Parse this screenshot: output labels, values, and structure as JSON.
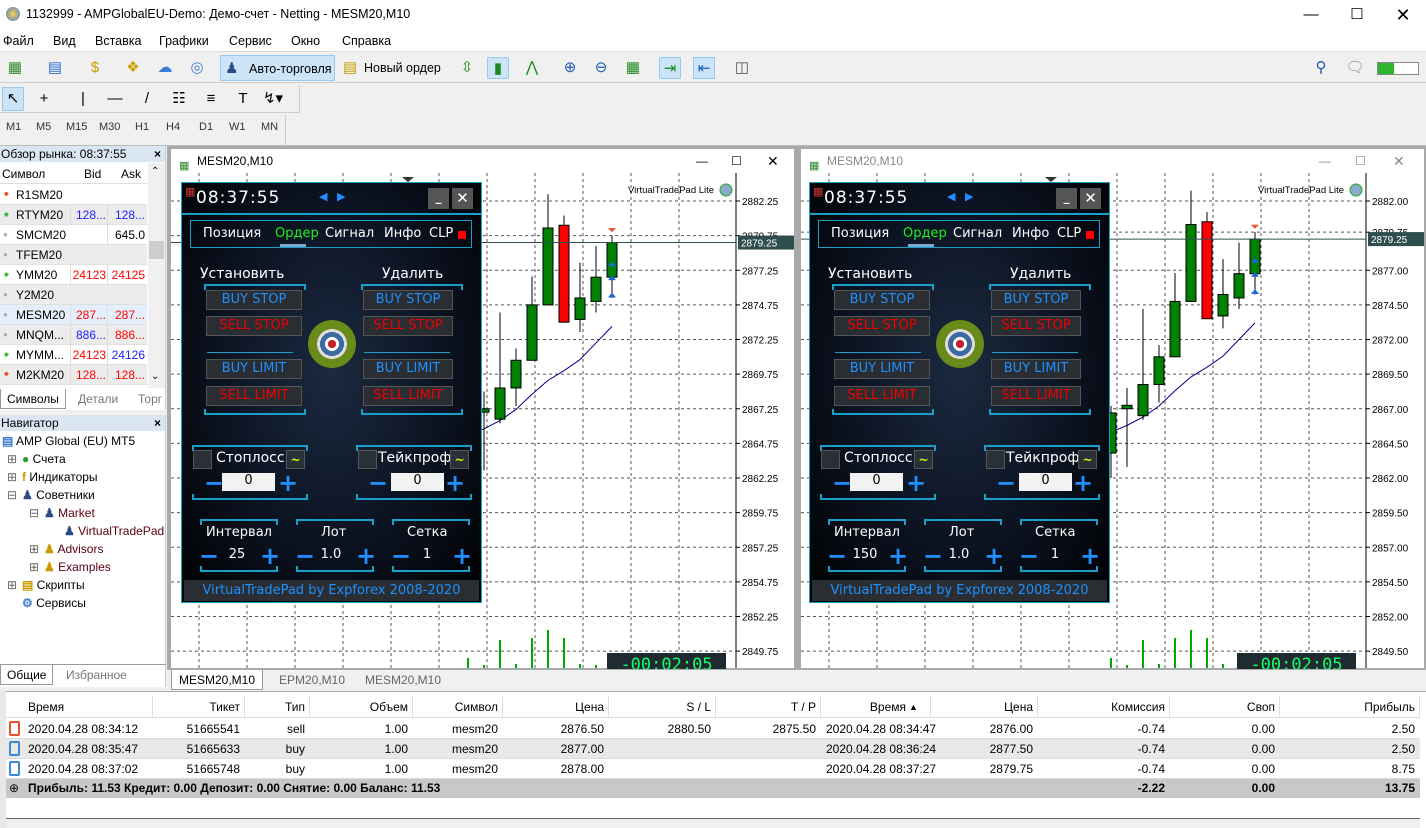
{
  "window": {
    "title": "1132999 - AMPGlobalEU-Demo: Демо-счет - Netting - MESM20,M10"
  },
  "menu": [
    "Файл",
    "Вид",
    "Вставка",
    "Графики",
    "Сервис",
    "Окно",
    "Справка"
  ],
  "toolbar": {
    "autotrading": "Авто-торговля",
    "new_order": "Новый ордер"
  },
  "timeframes": [
    "M1",
    "M5",
    "M15",
    "M30",
    "H1",
    "H4",
    "D1",
    "W1",
    "MN"
  ],
  "market_watch": {
    "title": "Обзор рынка: 08:37:55",
    "columns": [
      "Символ",
      "Bid",
      "Ask"
    ],
    "rows": [
      {
        "symbol": "R1SM20",
        "bid": "",
        "ask": "",
        "trend": "down",
        "bid_color": "#000",
        "ask_color": "#000"
      },
      {
        "symbol": "RTYM20",
        "bid": "128...",
        "ask": "128...",
        "trend": "up",
        "bid_color": "#2020ff",
        "ask_color": "#2020ff"
      },
      {
        "symbol": "SMCM20",
        "bid": "",
        "ask": "645.0",
        "trend": "none",
        "bid_color": "#000",
        "ask_color": "#000"
      },
      {
        "symbol": "TFEM20",
        "bid": "",
        "ask": "",
        "trend": "none",
        "bid_color": "#000",
        "ask_color": "#000"
      },
      {
        "symbol": "YMM20",
        "bid": "24123",
        "ask": "24125",
        "trend": "up",
        "bid_color": "#ff0000",
        "ask_color": "#ff0000"
      },
      {
        "symbol": "Y2M20",
        "bid": "",
        "ask": "",
        "trend": "none",
        "bid_color": "#000",
        "ask_color": "#000"
      },
      {
        "symbol": "MESM20",
        "bid": "287...",
        "ask": "287...",
        "trend": "none",
        "bid_color": "#ff0000",
        "ask_color": "#ff0000"
      },
      {
        "symbol": "MNQM...",
        "bid": "886...",
        "ask": "886...",
        "trend": "none",
        "bid_color": "#2020ff",
        "ask_color": "#ff0000"
      },
      {
        "symbol": "MYMM...",
        "bid": "24123",
        "ask": "24126",
        "trend": "up",
        "bid_color": "#ff0000",
        "ask_color": "#2020ff"
      },
      {
        "symbol": "M2KM20",
        "bid": "128...",
        "ask": "128...",
        "trend": "down",
        "bid_color": "#ff0000",
        "ask_color": "#ff0000"
      }
    ],
    "tabs": [
      "Символы",
      "Детали",
      "Торг"
    ]
  },
  "navigator": {
    "title": "Навигатор",
    "items": [
      "AMP Global (EU) MT5",
      "Счета",
      "Индикаторы",
      "Советники",
      "Market",
      "VirtualTradePad",
      "Advisors",
      "Examples",
      "Скрипты",
      "Сервисы"
    ],
    "tabs": [
      "Общие",
      "Избранное"
    ]
  },
  "charts": [
    {
      "title": "MESM20,M10",
      "ticks": [
        "2882.25",
        "2879.75",
        "2877.25",
        "2874.75",
        "2872.25",
        "2869.75",
        "2867.25",
        "2864.75",
        "2862.25",
        "2859.75",
        "2857.25",
        "2854.75",
        "2852.25",
        "2849.75"
      ],
      "current_price": "2879.25",
      "indicator_label": "VirtualTradePad  Lite",
      "countdown": "-00:02:05"
    },
    {
      "title": "MESM20,M10",
      "ticks": [
        "2882.00",
        "2879.75",
        "2877.00",
        "2874.50",
        "2872.00",
        "2869.50",
        "2867.00",
        "2864.50",
        "2862.00",
        "2859.50",
        "2857.00",
        "2854.50",
        "2852.00",
        "2849.50"
      ],
      "current_price": "2879.25",
      "indicator_label": "VirtualTradePad  Lite",
      "countdown": "-00:02:05"
    }
  ],
  "candles": [
    {
      "o": 2863.8,
      "h": 2867.2,
      "l": 2862.0,
      "c": 2866.7,
      "ma": 2865.3,
      "v": 10
    },
    {
      "o": 2867.0,
      "h": 2868.5,
      "l": 2862.8,
      "c": 2867.25,
      "ma": 2865.8,
      "v": 3
    },
    {
      "o": 2866.5,
      "h": 2874.2,
      "l": 2866.2,
      "c": 2868.75,
      "ma": 2866.4,
      "v": 28
    },
    {
      "o": 2868.75,
      "h": 2871.6,
      "l": 2867.45,
      "c": 2870.75,
      "ma": 2867.2,
      "v": 4
    },
    {
      "o": 2870.75,
      "h": 2876.8,
      "l": 2870.75,
      "c": 2874.75,
      "ma": 2868.3,
      "v": 30
    },
    {
      "o": 2874.75,
      "h": 2882.75,
      "l": 2874.75,
      "c": 2880.3,
      "ma": 2869.3,
      "v": 38
    },
    {
      "o": 2880.5,
      "h": 2881.2,
      "l": 2873.5,
      "c": 2873.5,
      "ma": 2870.0,
      "v": 30
    },
    {
      "o": 2873.7,
      "h": 2877.8,
      "l": 2872.8,
      "c": 2875.25,
      "ma": 2870.8,
      "v": 4
    },
    {
      "o": 2875.0,
      "h": 2879.0,
      "l": 2874.2,
      "c": 2876.75,
      "ma": 2872.0,
      "v": 3
    },
    {
      "o": 2876.75,
      "h": 2879.75,
      "l": 2875.25,
      "c": 2879.25,
      "ma": 2873.2,
      "v": 2
    }
  ],
  "panels": [
    {
      "time": "08:37:55",
      "tabs": [
        "Позиция",
        "Ордер",
        "Сигнал",
        "Инфо",
        "CLP"
      ],
      "set": "Установить",
      "del": "Удалить",
      "buy_stop": "BUY STOP",
      "sell_stop": "SELL STOP",
      "buy_limit": "BUY LIMIT",
      "sell_limit": "SELL LIMIT",
      "sl": "Стоплосс",
      "tp": "Тейкпроф",
      "sl_val": "0",
      "tp_val": "0",
      "interval": "Интервал",
      "lot": "Лот",
      "grid": "Сетка",
      "interval_val": "25",
      "lot_val": "1.0",
      "grid_val": "1",
      "footer": "VirtualTradePad by Expforex 2008-2020",
      "minus": "−",
      "plus": "+"
    },
    {
      "time": "08:37:55",
      "tabs": [
        "Позиция",
        "Ордер",
        "Сигнал",
        "Инфо",
        "CLP"
      ],
      "set": "Установить",
      "del": "Удалить",
      "buy_stop": "BUY STOP",
      "sell_stop": "SELL STOP",
      "buy_limit": "BUY LIMIT",
      "sell_limit": "SELL LIMIT",
      "sl": "Стоплосс",
      "tp": "Тейкпроф",
      "sl_val": "0",
      "tp_val": "0",
      "interval": "Интервал",
      "lot": "Лот",
      "grid": "Сетка",
      "interval_val": "150",
      "lot_val": "1.0",
      "grid_val": "1",
      "footer": "VirtualTradePad by Expforex 2008-2020",
      "minus": "−",
      "plus": "+"
    }
  ],
  "chart_tabs": [
    "MESM20,M10",
    "EPM20,M10",
    "MESM20,M10"
  ],
  "trade": {
    "columns": [
      "Время",
      "Тикет",
      "Тип",
      "Объем",
      "Символ",
      "Цена",
      "S / L",
      "T / P",
      "Время",
      "Цена",
      "Комиссия",
      "Своп",
      "Прибыль"
    ],
    "rows": [
      [
        "2020.04.28 08:34:12",
        "51665541",
        "sell",
        "1.00",
        "mesm20",
        "2876.50",
        "2880.50",
        "2875.50",
        "2020.04.28 08:34:47",
        "2876.00",
        "-0.74",
        "0.00",
        "2.50"
      ],
      [
        "2020.04.28 08:35:47",
        "51665633",
        "buy",
        "1.00",
        "mesm20",
        "2877.00",
        "",
        "",
        "2020.04.28 08:36:24",
        "2877.50",
        "-0.74",
        "0.00",
        "2.50"
      ],
      [
        "2020.04.28 08:37:02",
        "51665748",
        "buy",
        "1.00",
        "mesm20",
        "2878.00",
        "",
        "",
        "2020.04.28 08:37:27",
        "2879.75",
        "-0.74",
        "0.00",
        "8.75"
      ]
    ],
    "summary": "Прибыль: 11.53  Кредит: 0.00  Депозит: 0.00  Снятие: 0.00  Баланс: 11.53",
    "totals": {
      "commission": "-2.22",
      "swap": "0.00",
      "profit": "13.75"
    }
  }
}
